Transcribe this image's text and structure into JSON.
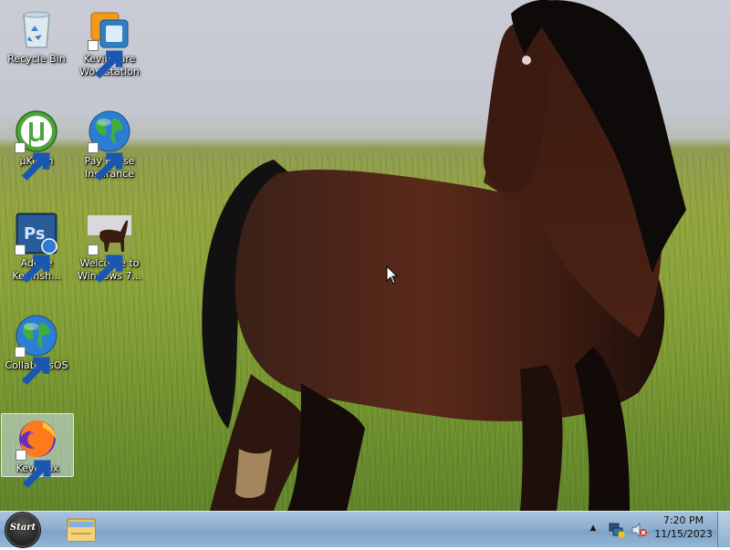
{
  "desktop": {
    "icons": [
      {
        "label": "Recycle Bin"
      },
      {
        "label": "Kevinware\nWorkstation"
      },
      {
        "label": "µKevin"
      },
      {
        "label": "Pay Horse\nInsurance"
      },
      {
        "label": "Adobe\nKevinsh..."
      },
      {
        "label": "Welcome to\nWindows 7..."
      },
      {
        "label": "CollabSysOS"
      },
      {
        "label": "Kevinfox"
      }
    ]
  },
  "taskbar": {
    "start_label": "Start",
    "clock": {
      "time": "7:20 PM",
      "date": "11/15/2023"
    }
  },
  "colors": {
    "taskbar": "#8fb0d0",
    "sky": "#c9ccd5",
    "grass": "#8aa23a",
    "horse": "#4a2316"
  }
}
